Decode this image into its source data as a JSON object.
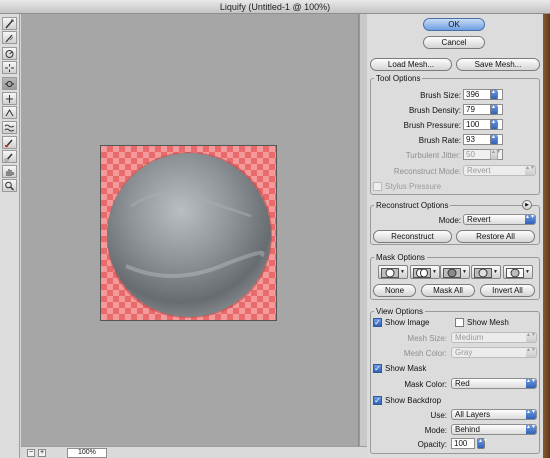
{
  "window": {
    "title": "Liquify (Untitled-1 @ 100%)"
  },
  "tools": [
    {
      "icon": "forward-warp-tool-icon"
    },
    {
      "icon": "reconstruct-tool-icon"
    },
    {
      "icon": "twirl-clockwise-tool-icon"
    },
    {
      "icon": "pucker-tool-icon"
    },
    {
      "icon": "bloat-tool-icon"
    },
    {
      "icon": "push-left-tool-icon"
    },
    {
      "icon": "mirror-tool-icon"
    },
    {
      "icon": "turbulence-tool-icon"
    },
    {
      "icon": "freeze-mask-tool-icon"
    },
    {
      "icon": "thaw-mask-tool-icon"
    },
    {
      "icon": "hand-tool-icon"
    },
    {
      "icon": "zoom-tool-icon"
    }
  ],
  "status": {
    "zoom_out": "−",
    "zoom_in": "+",
    "zoom": "100%"
  },
  "buttons": {
    "ok": "OK",
    "cancel": "Cancel",
    "load_mesh": "Load Mesh...",
    "save_mesh": "Save Mesh..."
  },
  "tool_options": {
    "title": "Tool Options",
    "brush_size": {
      "label": "Brush Size:",
      "value": "396"
    },
    "brush_density": {
      "label": "Brush Density:",
      "value": "79"
    },
    "brush_pressure": {
      "label": "Brush Pressure:",
      "value": "100"
    },
    "brush_rate": {
      "label": "Brush Rate:",
      "value": "93"
    },
    "turbulent_jitter": {
      "label": "Turbulent Jitter:",
      "value": "50"
    },
    "reconstruct_mode": {
      "label": "Reconstruct Mode:",
      "value": "Revert"
    },
    "stylus_pressure": {
      "label": "Stylus Pressure",
      "checked": false
    }
  },
  "reconstruct_options": {
    "title": "Reconstruct Options",
    "mode_label": "Mode:",
    "mode_value": "Revert",
    "reconstruct": "Reconstruct",
    "restore_all": "Restore All"
  },
  "mask_options": {
    "title": "Mask Options",
    "none": "None",
    "mask_all": "Mask All",
    "invert_all": "Invert All"
  },
  "view_options": {
    "title": "View Options",
    "show_image": "Show Image",
    "show_mesh": "Show Mesh",
    "mesh_size_label": "Mesh Size:",
    "mesh_size_value": "Medium",
    "mesh_color_label": "Mesh Color:",
    "mesh_color_value": "Gray",
    "show_mask": "Show Mask",
    "mask_color_label": "Mask Color:",
    "mask_color_value": "Red",
    "show_backdrop": "Show Backdrop",
    "use_label": "Use:",
    "use_value": "All Layers",
    "mode_label": "Mode:",
    "mode_value": "Behind",
    "opacity_label": "Opacity:",
    "opacity_value": "100"
  },
  "colors": {
    "mask_overlay": "#f08080",
    "default_button": "#6f9fe0"
  }
}
